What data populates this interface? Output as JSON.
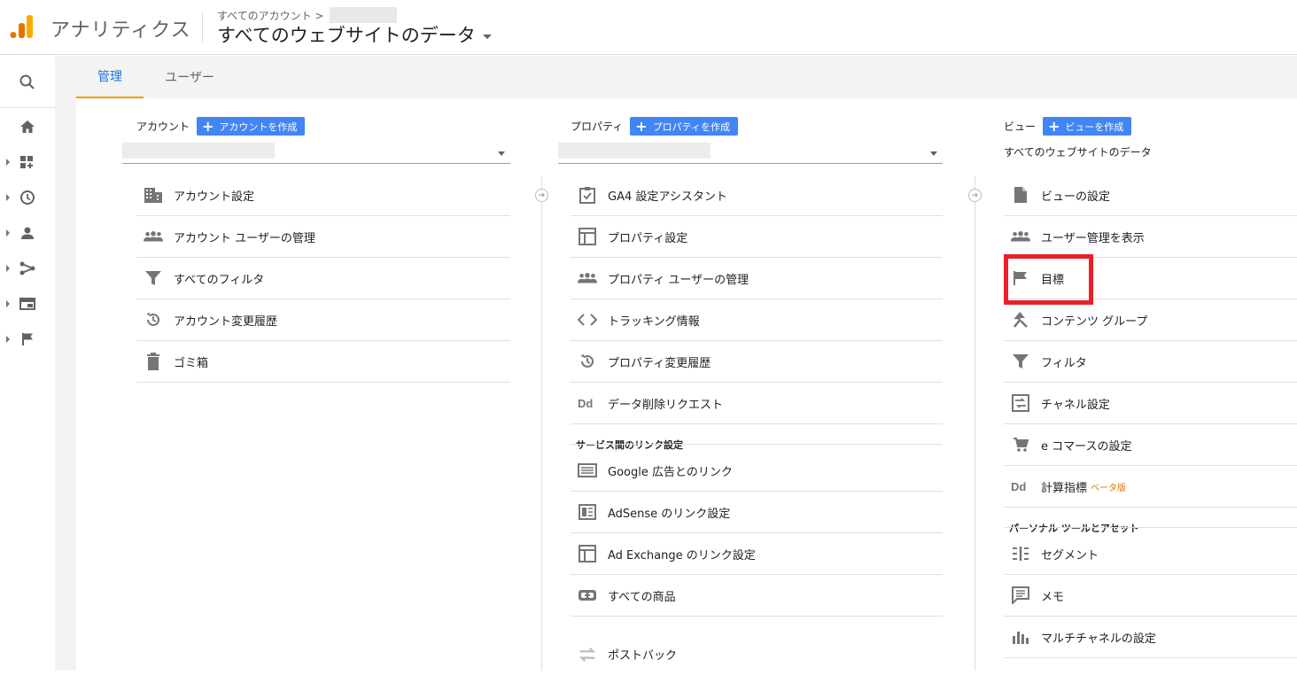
{
  "header": {
    "app_title": "アナリティクス",
    "breadcrumb": "すべてのアカウント >",
    "view_title": "すべてのウェブサイトのデータ"
  },
  "tabs": [
    {
      "label": "管理",
      "active": true
    },
    {
      "label": "ユーザー",
      "active": false
    }
  ],
  "account": {
    "heading": "アカウント",
    "create_label": "アカウントを作成",
    "items": [
      {
        "label": "アカウント設定",
        "icon": "building-icon"
      },
      {
        "label": "アカウント ユーザーの管理",
        "icon": "users-icon"
      },
      {
        "label": "すべてのフィルタ",
        "icon": "filter-icon"
      },
      {
        "label": "アカウント変更履歴",
        "icon": "history-icon"
      },
      {
        "label": "ゴミ箱",
        "icon": "trash-icon"
      }
    ]
  },
  "property": {
    "heading": "プロパティ",
    "create_label": "プロパティを作成",
    "items": [
      {
        "label": "GA4 設定アシスタント",
        "icon": "checklist-icon"
      },
      {
        "label": "プロパティ設定",
        "icon": "layout-icon"
      },
      {
        "label": "プロパティ ユーザーの管理",
        "icon": "users-icon"
      },
      {
        "label": "トラッキング情報",
        "icon": "code-icon"
      },
      {
        "label": "プロパティ変更履歴",
        "icon": "history-icon"
      },
      {
        "label": "データ削除リクエスト",
        "icon": "dd-icon"
      }
    ],
    "section_label": "サービス間のリンク設定",
    "link_items": [
      {
        "label": "Google 広告とのリンク",
        "icon": "ads-icon"
      },
      {
        "label": "AdSense のリンク設定",
        "icon": "adsense-icon"
      },
      {
        "label": "Ad Exchange のリンク設定",
        "icon": "layout-icon"
      },
      {
        "label": "すべての商品",
        "icon": "link-icon"
      },
      {
        "label": "ポストバック",
        "icon": "postback-icon"
      }
    ]
  },
  "view": {
    "heading": "ビュー",
    "create_label": "ビューを作成",
    "selected": "すべてのウェブサイトのデータ",
    "items": [
      {
        "label": "ビューの設定",
        "icon": "document-icon"
      },
      {
        "label": "ユーザー管理を表示",
        "icon": "users-icon"
      },
      {
        "label": "目標",
        "icon": "flag-icon"
      },
      {
        "label": "コンテンツ グループ",
        "icon": "content-group-icon"
      },
      {
        "label": "フィルタ",
        "icon": "filter-icon"
      },
      {
        "label": "チャネル設定",
        "icon": "channel-icon"
      },
      {
        "label": "e コマースの設定",
        "icon": "cart-icon"
      },
      {
        "label": "計算指標",
        "icon": "dd-icon",
        "badge": "ベータ版"
      }
    ],
    "section_label": "パーソナル ツールとアセット",
    "personal_items": [
      {
        "label": "セグメント",
        "icon": "segment-icon"
      },
      {
        "label": "メモ",
        "icon": "note-icon"
      },
      {
        "label": "マルチチャネルの設定",
        "icon": "bar-chart-icon"
      }
    ]
  },
  "colors": {
    "accent": "#1a73e8",
    "button": "#4285f4",
    "tab_indicator": "#f29900",
    "highlight": "#e8202a"
  }
}
